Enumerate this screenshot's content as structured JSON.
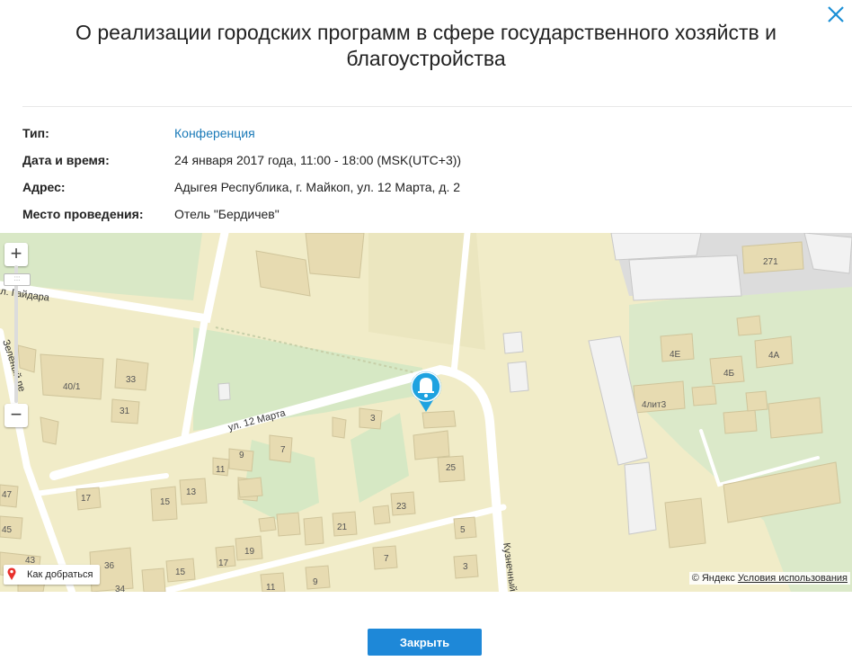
{
  "dialog": {
    "title": "О реализации городских программ в сфере государственного хозяйств и благоустройства",
    "close_button_label": "Закрыть"
  },
  "details": {
    "type": {
      "label": "Тип:",
      "value": "Конференция"
    },
    "datetime": {
      "label": "Дата и время:",
      "value": "24 января 2017 года, 11:00 - 18:00 (MSK(UTC+3))"
    },
    "address": {
      "label": "Адрес:",
      "value": "Адыгея Республика, г. Майкоп, ул. 12 Марта, д. 2"
    },
    "venue": {
      "label": "Место проведения:",
      "value": "Отель \"Бердичев\""
    }
  },
  "map": {
    "route_label": "Как добраться",
    "attribution": "© Яндекс",
    "terms_link": "Условия использования",
    "zoom_in_label": "+",
    "zoom_out_label": "−",
    "zoom_handle_label": ":::",
    "streets": {
      "march12": "ул. 12 Марта",
      "gaidara": "л. Гайдара",
      "zeleny": "Зелёный пе",
      "kuznech": "Кузнечный"
    },
    "buildings": {
      "b271": "271",
      "b4e": "4Е",
      "b4a": "4А",
      "b4b": "4Б",
      "b4lit3": "4лит3",
      "b40_1": "40/1",
      "b33": "33",
      "b31": "31",
      "b3": "3",
      "b7": "7",
      "b9": "9",
      "b11": "11",
      "b25": "25",
      "b17a": "17",
      "b15a": "15",
      "b13": "13",
      "b23": "23",
      "b21": "21",
      "b19": "19",
      "b17b": "17",
      "b15b": "15",
      "b5": "5",
      "b7b": "7",
      "b3b": "3",
      "b36": "36",
      "b47": "47",
      "b45": "45",
      "b43": "43",
      "b9b": "9",
      "b34": "34",
      "b11b": "11"
    },
    "colors": {
      "land": "#f1ecc8",
      "green": "#d6e8c4",
      "road": "#ffffff",
      "building": "#e7dbb1",
      "marker": "#1ea2e0"
    }
  }
}
